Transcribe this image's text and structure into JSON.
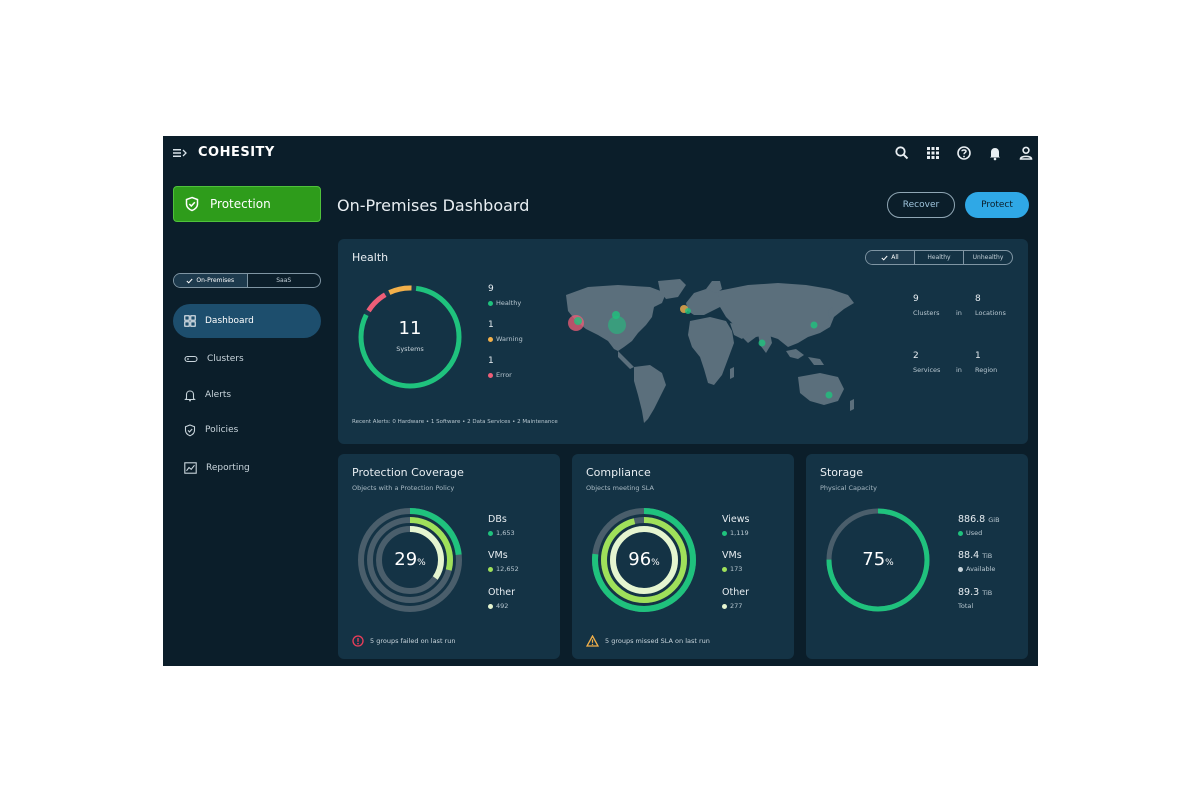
{
  "app": {
    "logo": "COHESITY"
  },
  "sidebar": {
    "protection_label": "Protection",
    "env_toggle": [
      "On-Premises",
      "SaaS"
    ],
    "items": [
      {
        "label": "Dashboard",
        "icon": "dashboard-icon",
        "active": true
      },
      {
        "label": "Clusters",
        "icon": "clusters-icon",
        "active": false
      },
      {
        "label": "Alerts",
        "icon": "bell-icon",
        "active": false
      },
      {
        "label": "Policies",
        "icon": "shield-icon",
        "active": false
      },
      {
        "label": "Reporting",
        "icon": "chart-icon",
        "active": false
      }
    ]
  },
  "header": {
    "title": "On-Premises Dashboard",
    "recover_label": "Recover",
    "protect_label": "Protect"
  },
  "health": {
    "title": "Health",
    "filters": [
      "All",
      "Healthy",
      "Unhealthy"
    ],
    "systems_count": "11",
    "systems_label": "Systems",
    "legend": [
      {
        "count": "9",
        "label": "Healthy",
        "color": "#1fc27d"
      },
      {
        "count": "1",
        "label": "Warning",
        "color": "#f2b04a"
      },
      {
        "count": "1",
        "label": "Error",
        "color": "#ee5e77"
      }
    ],
    "stats": [
      {
        "count": "9",
        "label": "Clusters",
        "in": "in",
        "count2": "8",
        "label2": "Locations"
      },
      {
        "count": "2",
        "label": "Services",
        "in": "in",
        "count2": "1",
        "label2": "Region"
      }
    ],
    "recent_alerts": "Recent Alerts: 0 Hardware  •  1 Software  •  2 Data Services  •  2 Maintenance"
  },
  "protection": {
    "title": "Protection Coverage",
    "subtitle": "Objects with a Protection Policy",
    "percent": "29",
    "percent_sign": "%",
    "legend": [
      {
        "title": "DBs",
        "value": "1,653",
        "color": "#1fc27d"
      },
      {
        "title": "VMs",
        "value": "12,652",
        "color": "#9fe05a"
      },
      {
        "title": "Other",
        "value": "492",
        "color": "#e5f5d0"
      }
    ],
    "footer": "5 groups failed on last run"
  },
  "compliance": {
    "title": "Compliance",
    "subtitle": "Objects meeting SLA",
    "percent": "96",
    "percent_sign": "%",
    "legend": [
      {
        "title": "Views",
        "value": "1,119",
        "color": "#1fc27d"
      },
      {
        "title": "VMs",
        "value": "173",
        "color": "#9fe05a"
      },
      {
        "title": "Other",
        "value": "277",
        "color": "#e5f5d0"
      }
    ],
    "footer": "5 groups missed SLA on last run"
  },
  "storage": {
    "title": "Storage",
    "subtitle": "Physical Capacity",
    "percent": "75",
    "percent_sign": "%",
    "legend": [
      {
        "title": "886.8",
        "unit": "GiB",
        "value": "Used",
        "color": "#1fc27d"
      },
      {
        "title": "88.4",
        "unit": "TiB",
        "value": "Available",
        "color": "#c9d5dc"
      },
      {
        "title": "89.3",
        "unit": "TiB",
        "value": "Total",
        "color": ""
      }
    ]
  },
  "colors": {
    "accent_green": "#2e9c1b",
    "accent_blue": "#2fa8e6",
    "healthy": "#1fc27d",
    "warning": "#f2b04a",
    "error": "#ee5e77"
  }
}
